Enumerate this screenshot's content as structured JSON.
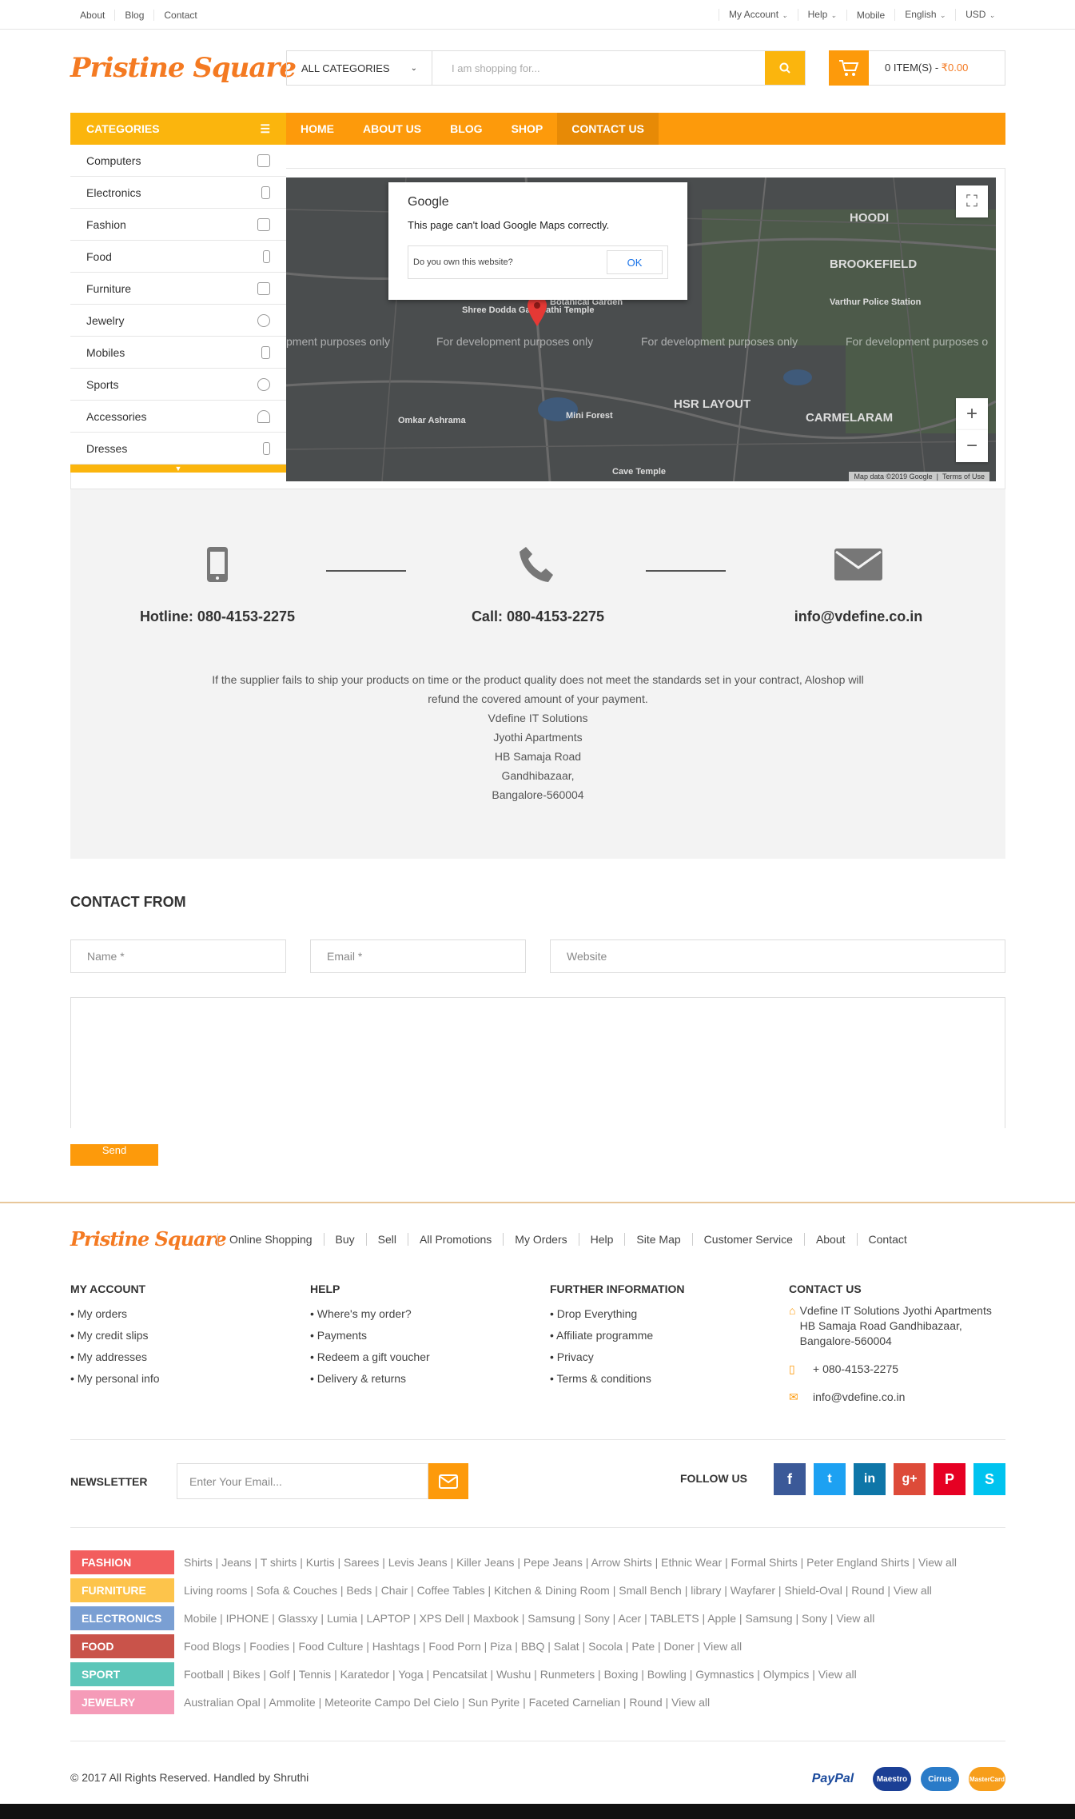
{
  "topbar": {
    "left": [
      "About",
      "Blog",
      "Contact"
    ],
    "my_account": "My Account",
    "help": "Help",
    "mobile": "Mobile",
    "language": "English",
    "currency": "USD"
  },
  "header": {
    "logo": "Pristine Square",
    "category_select": "ALL CATEGORIES",
    "search_placeholder": "I am shopping for...",
    "cart_text": "0 ITEM(S) - ",
    "cart_total": "₹0.00"
  },
  "nav": {
    "categories_label": "CATEGORIES",
    "links": [
      "HOME",
      "ABOUT US",
      "BLOG",
      "SHOP",
      "CONTACT US"
    ]
  },
  "categories": [
    "Computers",
    "Electronics",
    "Fashion",
    "Food",
    "Furniture",
    "Jewelry",
    "Mobiles",
    "Sports",
    "Accessories",
    "Dresses"
  ],
  "map": {
    "dialog_title": "Google",
    "dialog_message": "This page can't load Google Maps correctly.",
    "dialog_question": "Do you own this website?",
    "dialog_ok": "OK",
    "dev_text": "For development purposes only",
    "dev_text_left": "pment purposes only",
    "dev_text_right": "For development purposes o",
    "labels": [
      "HOODI",
      "BROOKEFIELD",
      "HSR LAYOUT",
      "CARMELARAM",
      "Mini Forest",
      "Cave Temple",
      "Botanical Garden",
      "Shree Dodda Ganapathi Temple",
      "Varthur Police Station",
      "Omkar Ashrama"
    ],
    "attribution": "Map data ©2019 Google",
    "terms": "Terms of Use"
  },
  "info": {
    "hotline": "Hotline: 080-4153-2275",
    "call": "Call: 080-4153-2275",
    "email": "info@vdefine.co.in",
    "paragraph": "If the supplier fails to ship your products on time or the product quality does not meet the standards set in your contract, Aloshop will refund the covered amount of your payment.",
    "address": [
      "Vdefine IT Solutions",
      "Jyothi Apartments",
      "HB Samaja Road",
      "Gandhibazaar,",
      "Bangalore-560004"
    ]
  },
  "contact_form": {
    "title": "CONTACT FROM",
    "name_placeholder": "Name *",
    "email_placeholder": "Email *",
    "website_placeholder": "Website",
    "send": "Send"
  },
  "footer": {
    "logo": "Pristine Square",
    "links": [
      "Online Shopping",
      "Buy",
      "Sell",
      "All Promotions",
      "My Orders",
      "Help",
      "Site Map",
      "Customer Service",
      "About",
      "Contact"
    ],
    "my_account": {
      "title": "MY ACCOUNT",
      "items": [
        "My orders",
        "My credit slips",
        "My addresses",
        "My personal info"
      ]
    },
    "help": {
      "title": "HELP",
      "items": [
        "Where's my order?",
        "Payments",
        "Redeem a gift voucher",
        "Delivery & returns"
      ]
    },
    "further": {
      "title": "FURTHER INFORMATION",
      "items": [
        "Drop Everything",
        "Affiliate programme",
        "Privacy",
        "Terms & conditions"
      ]
    },
    "contact": {
      "title": "CONTACT US",
      "address": "Vdefine IT Solutions Jyothi Apartments HB Samaja Road Gandhibazaar, Bangalore-560004",
      "phone": "+ 080-4153-2275",
      "email": "info@vdefine.co.in"
    },
    "newsletter_title": "NEWSLETTER",
    "newsletter_placeholder": "Enter Your Email...",
    "follow_us": "FOLLOW US",
    "copyright": "© 2017  All Rights Reserved. Handled by Shruthi"
  },
  "tags": [
    {
      "label": "FASHION",
      "color": "#f25e5e",
      "links": "Shirts | Jeans | T shirts | Kurtis | Sarees | Levis Jeans | Killer Jeans | Pepe Jeans | Arrow Shirts | Ethnic Wear | Formal Shirts | Peter England Shirts | View all"
    },
    {
      "label": "FURNITURE",
      "color": "#fdc44b",
      "links": "Living rooms | Sofa & Couches | Beds | Chair | Coffee Tables | Kitchen & Dining Room | Small Bench | library | Wayfarer | Shield-Oval | Round | View all"
    },
    {
      "label": "ELECTRONICS",
      "color": "#7a9fd3",
      "links": "Mobile | IPHONE | Glassxy | Lumia | LAPTOP | XPS Dell | Maxbook | Samsung | Sony | Acer | TABLETS | Apple | Samsung | Sony | View all"
    },
    {
      "label": "FOOD",
      "color": "#c9534a",
      "links": "Food Blogs | Foodies | Food Culture | Hashtags | Food Porn | Piza | BBQ | Salat | Socola | Pate | Doner | View all"
    },
    {
      "label": "SPORT",
      "color": "#5cc6b9",
      "links": "Football | Bikes | Golf | Tennis | Karatedor | Yoga | Pencatsilat | Wushu | Runmeters | Boxing | Bowling | Gymnastics | Olympics | View all"
    },
    {
      "label": "JEWELRY",
      "color": "#f59bb8",
      "links": "Australian Opal | Ammolite | Meteorite Campo Del Cielo | Sun Pyrite | Faceted Carnelian | Round | View all"
    }
  ],
  "payments": [
    "PayPal",
    "Maestro",
    "Cirrus",
    "MasterCard"
  ]
}
